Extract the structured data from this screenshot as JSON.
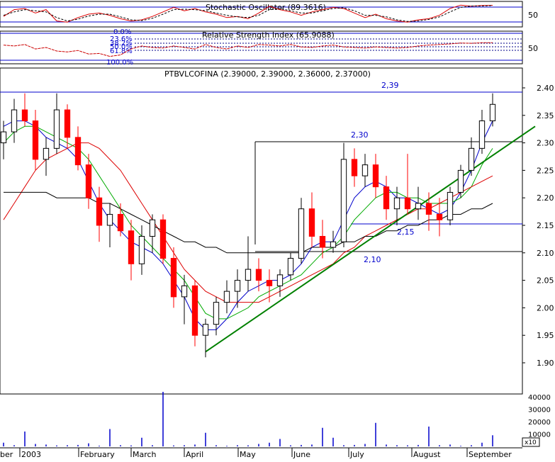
{
  "chart_data": [
    {
      "type": "line",
      "title": "Stochastic Oscillator (89.3616)",
      "yticks": [
        50
      ],
      "ylim": [
        0,
        100
      ],
      "series": [
        {
          "values": [
            40,
            70,
            75,
            55,
            70,
            20,
            15,
            35,
            50,
            55,
            45,
            30,
            20,
            25,
            40,
            60,
            80,
            65,
            75,
            60,
            50,
            35,
            40,
            30,
            55,
            85,
            70,
            60,
            45,
            60,
            70,
            80,
            75,
            55,
            35,
            50,
            30,
            20,
            15,
            25,
            30,
            45,
            75,
            90,
            85,
            88,
            89
          ]
        },
        {
          "values": [
            45,
            60,
            70,
            65,
            60,
            35,
            20,
            28,
            42,
            50,
            50,
            38,
            25,
            22,
            32,
            50,
            70,
            72,
            70,
            66,
            55,
            45,
            38,
            35,
            45,
            70,
            75,
            65,
            55,
            55,
            65,
            75,
            78,
            65,
            45,
            45,
            38,
            25,
            18,
            20,
            27,
            38,
            60,
            80,
            86,
            86,
            88
          ]
        }
      ]
    },
    {
      "type": "line",
      "title": "Relative Strength Index (65.9088)",
      "yticks": [
        50
      ],
      "ylim": [
        0,
        100
      ],
      "fib_levels": [
        "0.0%",
        "23.6%",
        "38.2%",
        "50.0%",
        "61.8%",
        "100.0%"
      ],
      "series": [
        {
          "values": [
            58,
            55,
            60,
            45,
            50,
            38,
            35,
            40,
            28,
            30,
            20,
            25,
            45,
            55,
            50,
            48,
            55,
            50,
            45,
            60,
            50,
            45,
            55,
            50,
            60,
            58,
            55,
            60,
            52,
            50,
            55,
            58,
            52,
            50,
            48,
            52,
            50,
            48,
            50,
            55,
            58,
            60,
            62,
            65,
            64,
            66,
            66
          ]
        }
      ]
    },
    {
      "type": "candlestick",
      "title": "PTBVLCOFINA (2.39000, 2.39000, 2.36000, 2.37000)",
      "ylim": [
        1.86,
        2.43
      ],
      "yticks": [
        "1.90",
        "1.95",
        "2.00",
        "2.05",
        "2.10",
        "2.15",
        "2.20",
        "2.25",
        "2.30",
        "2.35",
        "2.40"
      ],
      "x_months": [
        "ber",
        "2003",
        "February",
        "March",
        "April",
        "May",
        "June",
        "July",
        "August",
        "September"
      ],
      "annotations": [
        {
          "label": "2,39",
          "y": 2.39
        },
        {
          "label": "2,30",
          "y": 2.3
        },
        {
          "label": "2,15",
          "y": 2.15
        },
        {
          "label": "2,10",
          "y": 2.1
        }
      ],
      "ohlc": [
        [
          2.3,
          2.34,
          2.27,
          2.32
        ],
        [
          2.32,
          2.38,
          2.3,
          2.36
        ],
        [
          2.36,
          2.39,
          2.33,
          2.34
        ],
        [
          2.34,
          2.36,
          2.25,
          2.27
        ],
        [
          2.27,
          2.31,
          2.24,
          2.29
        ],
        [
          2.29,
          2.39,
          2.28,
          2.36
        ],
        [
          2.36,
          2.37,
          2.29,
          2.31
        ],
        [
          2.31,
          2.33,
          2.25,
          2.26
        ],
        [
          2.26,
          2.28,
          2.18,
          2.2
        ],
        [
          2.2,
          2.22,
          2.12,
          2.15
        ],
        [
          2.15,
          2.19,
          2.11,
          2.17
        ],
        [
          2.17,
          2.19,
          2.13,
          2.14
        ],
        [
          2.14,
          2.16,
          2.05,
          2.08
        ],
        [
          2.08,
          2.15,
          2.06,
          2.13
        ],
        [
          2.13,
          2.17,
          2.1,
          2.16
        ],
        [
          2.16,
          2.17,
          2.08,
          2.09
        ],
        [
          2.09,
          2.11,
          2.0,
          2.02
        ],
        [
          2.02,
          2.06,
          1.97,
          2.04
        ],
        [
          2.04,
          2.05,
          1.93,
          1.95
        ],
        [
          1.95,
          1.98,
          1.91,
          1.97
        ],
        [
          1.97,
          2.02,
          1.95,
          2.01
        ],
        [
          2.01,
          2.05,
          1.99,
          2.03
        ],
        [
          2.03,
          2.07,
          2.0,
          2.05
        ],
        [
          2.05,
          2.13,
          2.03,
          2.07
        ],
        [
          2.07,
          2.09,
          2.03,
          2.05
        ],
        [
          2.05,
          2.07,
          2.01,
          2.04
        ],
        [
          2.04,
          2.07,
          2.02,
          2.06
        ],
        [
          2.06,
          2.1,
          2.05,
          2.09
        ],
        [
          2.09,
          2.2,
          2.08,
          2.18
        ],
        [
          2.18,
          2.21,
          2.11,
          2.13
        ],
        [
          2.13,
          2.16,
          2.09,
          2.11
        ],
        [
          2.11,
          2.14,
          2.1,
          2.12
        ],
        [
          2.12,
          2.3,
          2.11,
          2.27
        ],
        [
          2.27,
          2.29,
          2.22,
          2.24
        ],
        [
          2.24,
          2.28,
          2.22,
          2.26
        ],
        [
          2.26,
          2.28,
          2.2,
          2.22
        ],
        [
          2.22,
          2.24,
          2.16,
          2.18
        ],
        [
          2.18,
          2.22,
          2.15,
          2.2
        ],
        [
          2.2,
          2.28,
          2.17,
          2.18
        ],
        [
          2.18,
          2.22,
          2.16,
          2.19
        ],
        [
          2.19,
          2.21,
          2.14,
          2.17
        ],
        [
          2.17,
          2.2,
          2.13,
          2.16
        ],
        [
          2.16,
          2.22,
          2.15,
          2.21
        ],
        [
          2.21,
          2.26,
          2.2,
          2.25
        ],
        [
          2.25,
          2.31,
          2.24,
          2.29
        ],
        [
          2.29,
          2.36,
          2.28,
          2.34
        ],
        [
          2.34,
          2.39,
          2.33,
          2.37
        ]
      ],
      "moving_averages": [
        {
          "color": "#0000cc",
          "values": [
            2.33,
            2.34,
            2.34,
            2.33,
            2.31,
            2.3,
            2.29,
            2.27,
            2.23,
            2.19,
            2.16,
            2.14,
            2.12,
            2.11,
            2.1,
            2.08,
            2.05,
            2.02,
            1.98,
            1.96,
            1.96,
            1.98,
            2.01,
            2.03,
            2.04,
            2.05,
            2.05,
            2.06,
            2.08,
            2.11,
            2.12,
            2.12,
            2.16,
            2.2,
            2.22,
            2.23,
            2.22,
            2.2,
            2.2,
            2.19,
            2.18,
            2.17,
            2.18,
            2.21,
            2.25,
            2.3,
            2.34
          ]
        },
        {
          "color": "#00aa00",
          "values": [
            2.3,
            2.32,
            2.33,
            2.33,
            2.32,
            2.31,
            2.3,
            2.29,
            2.27,
            2.24,
            2.21,
            2.18,
            2.15,
            2.13,
            2.11,
            2.09,
            2.07,
            2.05,
            2.02,
            1.99,
            1.98,
            1.98,
            1.99,
            2.0,
            2.02,
            2.03,
            2.04,
            2.05,
            2.06,
            2.08,
            2.1,
            2.11,
            2.13,
            2.16,
            2.18,
            2.2,
            2.21,
            2.21,
            2.2,
            2.2,
            2.19,
            2.19,
            2.19,
            2.2,
            2.22,
            2.26,
            2.29
          ]
        },
        {
          "color": "#dd0000",
          "values": [
            2.16,
            2.19,
            2.22,
            2.25,
            2.27,
            2.28,
            2.29,
            2.3,
            2.3,
            2.29,
            2.27,
            2.25,
            2.22,
            2.19,
            2.16,
            2.13,
            2.1,
            2.07,
            2.05,
            2.03,
            2.02,
            2.01,
            2.01,
            2.01,
            2.01,
            2.02,
            2.03,
            2.04,
            2.05,
            2.06,
            2.07,
            2.08,
            2.1,
            2.11,
            2.13,
            2.14,
            2.15,
            2.16,
            2.17,
            2.18,
            2.18,
            2.19,
            2.2,
            2.21,
            2.22,
            2.23,
            2.24
          ]
        },
        {
          "color": "#000000",
          "values": [
            2.21,
            2.21,
            2.21,
            2.21,
            2.21,
            2.2,
            2.2,
            2.2,
            2.2,
            2.19,
            2.19,
            2.18,
            2.17,
            2.16,
            2.15,
            2.14,
            2.13,
            2.12,
            2.12,
            2.11,
            2.11,
            2.1,
            2.1,
            2.1,
            2.1,
            2.1,
            2.1,
            2.1,
            2.1,
            2.11,
            2.11,
            2.11,
            2.12,
            2.12,
            2.13,
            2.13,
            2.14,
            2.14,
            2.15,
            2.15,
            2.16,
            2.16,
            2.17,
            2.17,
            2.18,
            2.18,
            2.19
          ]
        }
      ],
      "trendline": {
        "color": "#008000",
        "from": [
          19,
          1.92
        ],
        "to": [
          50,
          2.33
        ]
      }
    },
    {
      "type": "bar",
      "title": "",
      "yticks": [
        "40000",
        "30000",
        "20000",
        "10000"
      ],
      "multiplier_label": "x10",
      "values": [
        3000,
        1000,
        12000,
        2000,
        1500,
        800,
        1000,
        1200,
        2500,
        600,
        14000,
        1000,
        800,
        7000,
        1000,
        44000,
        800,
        1000,
        1500,
        11000,
        1000,
        500,
        1000,
        900,
        2000,
        3000,
        6000,
        900,
        1200,
        1500,
        15000,
        7000,
        1000,
        1200,
        2000,
        19000,
        1500,
        1000,
        900,
        1200,
        16000,
        1000,
        1500,
        500,
        1000,
        3000,
        9000
      ]
    }
  ]
}
